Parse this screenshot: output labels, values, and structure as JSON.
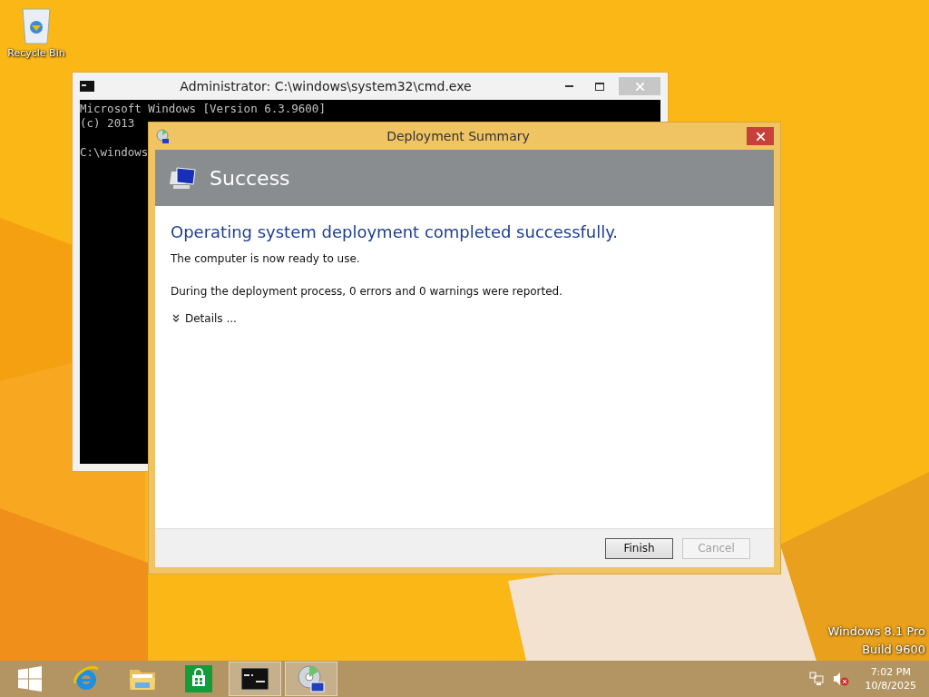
{
  "desktop_icons": [
    {
      "label": "Recycle Bin"
    }
  ],
  "console_window": {
    "title": "Administrator: C:\\windows\\system32\\cmd.exe",
    "lines": [
      "Microsoft Windows [Version 6.3.9600]",
      "(c) 2013"
    ],
    "prompt": "C:\\windows"
  },
  "dialog": {
    "title": "Deployment Summary",
    "header": "Success",
    "heading": "Operating system deployment completed successfully.",
    "paragraphs": [
      "The computer is now ready to use.",
      "During the deployment process, 0 errors and 0 warnings were reported."
    ],
    "details": {
      "label": "Details ...",
      "expanded": false
    },
    "buttons": [
      {
        "label": "Finish",
        "disabled": false,
        "default": true
      },
      {
        "label": "Cancel",
        "disabled": true,
        "default": false
      }
    ]
  },
  "watermark": [
    "Windows 8.1 Pro",
    "Build 9600"
  ],
  "taskbar": {
    "items": [
      {
        "kind": "start",
        "active": false
      },
      {
        "kind": "browser",
        "active": false
      },
      {
        "kind": "folder",
        "active": false
      },
      {
        "kind": "store",
        "active": false
      },
      {
        "kind": "console",
        "active": true
      },
      {
        "kind": "disc",
        "active": true
      }
    ],
    "clock": {
      "time": "7:02 PM",
      "date": "10/8/2025"
    }
  }
}
